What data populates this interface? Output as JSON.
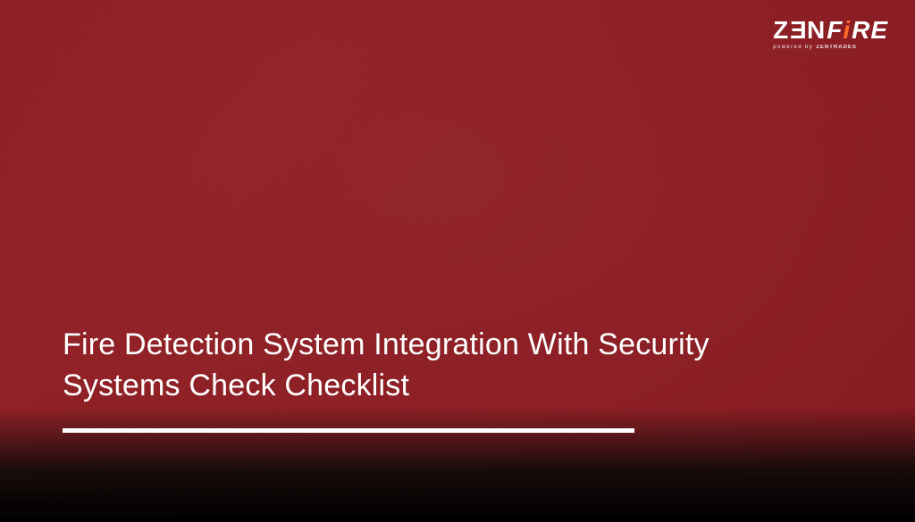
{
  "logo": {
    "z": "Z",
    "e": "E",
    "n": "N",
    "f": "F",
    "i": "i",
    "re": "RE",
    "tagline_prefix": "powered by ",
    "tagline_brand": "ZENTRADES"
  },
  "hero": {
    "title": "Fire Detection System Integration With Security Systems Check Checklist"
  }
}
